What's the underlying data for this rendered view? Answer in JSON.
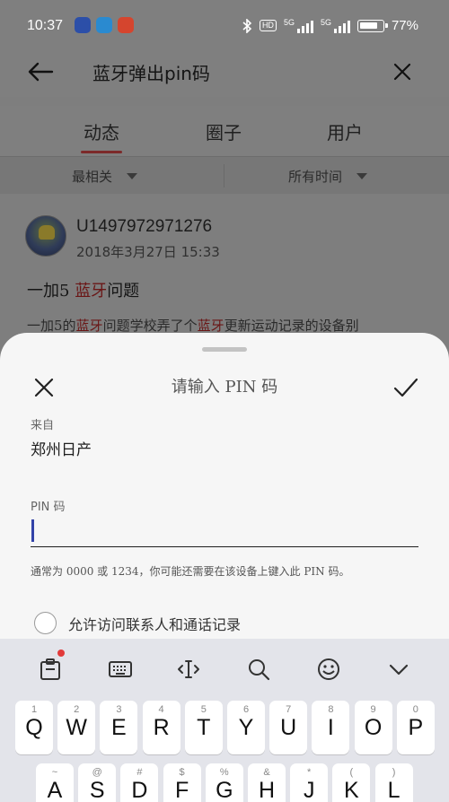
{
  "status_bar": {
    "time": "10:37",
    "hd": "HD",
    "net1": "5G",
    "net2": "5G",
    "battery": "77%",
    "app_icons": [
      "app-icon-1",
      "app-icon-2",
      "app-icon-3"
    ]
  },
  "search": {
    "query": "蓝牙弹出pin码"
  },
  "tabs": [
    {
      "label": "动态",
      "active": true
    },
    {
      "label": "圈子",
      "active": false
    },
    {
      "label": "用户",
      "active": false
    }
  ],
  "filters": {
    "sort": "最相关",
    "time": "所有时间"
  },
  "post": {
    "username": "U1497972971276",
    "date": "2018年3月27日  15:33",
    "title_prefix": "一加5 ",
    "title_highlight": "蓝牙",
    "title_suffix": "问题",
    "snippet_1": "一加5的",
    "snippet_hl_1": "蓝牙",
    "snippet_2": "问题学校弄了个",
    "snippet_hl_2": "蓝牙",
    "snippet_3": "更新运动记录的设备别"
  },
  "dialog": {
    "title": "请输入 PIN 码",
    "from_label": "来自",
    "from_value": "郑州日产",
    "pin_label": "PIN 码",
    "pin_value": "",
    "hint": "通常为 0000 或 1234，你可能还需要在该设备上键入此 PIN 码。",
    "allow_label": "允许访问联系人和通话记录",
    "allow_checked": false
  },
  "keyboard": {
    "toolbar": [
      "clipboard-icon",
      "keyboard-layout-icon",
      "cursor-move-icon",
      "search-icon",
      "emoji-icon",
      "collapse-keyboard-icon"
    ],
    "row1": [
      {
        "hint": "1",
        "ch": "Q"
      },
      {
        "hint": "2",
        "ch": "W"
      },
      {
        "hint": "3",
        "ch": "E"
      },
      {
        "hint": "4",
        "ch": "R"
      },
      {
        "hint": "5",
        "ch": "T"
      },
      {
        "hint": "6",
        "ch": "Y"
      },
      {
        "hint": "7",
        "ch": "U"
      },
      {
        "hint": "8",
        "ch": "I"
      },
      {
        "hint": "9",
        "ch": "O"
      },
      {
        "hint": "0",
        "ch": "P"
      }
    ],
    "row2": [
      {
        "hint": "~",
        "ch": "A"
      },
      {
        "hint": "@",
        "ch": "S"
      },
      {
        "hint": "#",
        "ch": "D"
      },
      {
        "hint": "$",
        "ch": "F"
      },
      {
        "hint": "%",
        "ch": "G"
      },
      {
        "hint": "&",
        "ch": "H"
      },
      {
        "hint": "*",
        "ch": "J"
      },
      {
        "hint": "(",
        "ch": "K"
      },
      {
        "hint": ")",
        "ch": "L"
      }
    ]
  }
}
